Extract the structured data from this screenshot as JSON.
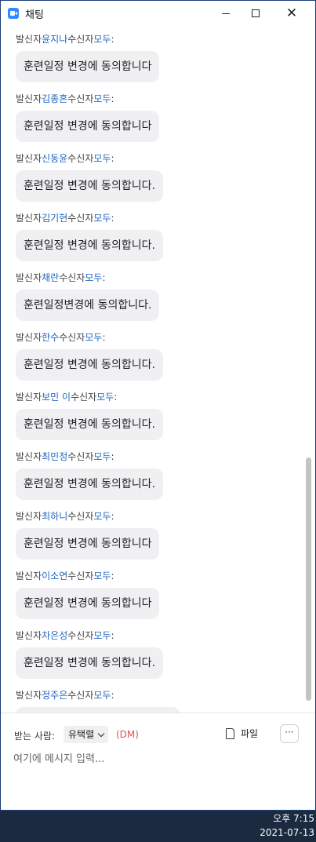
{
  "window": {
    "title": "채팅"
  },
  "messages": [
    {
      "prefix": "발신자",
      "sender": "윤지나",
      "mid": "수신자",
      "to": "모두",
      "suffix": ":",
      "text": "훈련일정 변경에 동의합니다"
    },
    {
      "prefix": "발신자",
      "sender": "김종흔",
      "mid": "수신자",
      "to": "모두",
      "suffix": ":",
      "text": "훈련일정 변경에 동의합니다"
    },
    {
      "prefix": "발신자",
      "sender": "신동윤",
      "mid": "수신자",
      "to": "모두",
      "suffix": ":",
      "text": "훈련일정 변경에 동의합니다."
    },
    {
      "prefix": "발신자",
      "sender": "김기현",
      "mid": "수신자",
      "to": "모두",
      "suffix": ":",
      "text": "훈련일정 변경에 동의합니다."
    },
    {
      "prefix": "발신자",
      "sender": "채란",
      "mid": "수신자",
      "to": "모두",
      "suffix": ":",
      "text": "훈련일정변경에 동의합니다."
    },
    {
      "prefix": "발신자",
      "sender": "한수",
      "mid": "수신자",
      "to": "모두",
      "suffix": ":",
      "text": "훈련일정 변경에 동의합니다."
    },
    {
      "prefix": "발신자",
      "sender": "보민 이",
      "mid": "수신자",
      "to": "모두",
      "suffix": ":",
      "text": "훈련일정 변경에 동의합니다."
    },
    {
      "prefix": "발신자",
      "sender": "최민정",
      "mid": "수신자",
      "to": "모두",
      "suffix": ":",
      "text": "훈련일정 변경에 동의합니다."
    },
    {
      "prefix": "발신자",
      "sender": "최하니",
      "mid": "수신자",
      "to": "모두",
      "suffix": ":",
      "text": "훈련일정 변경에 동의합니다"
    },
    {
      "prefix": "발신자",
      "sender": "이소연",
      "mid": "수신자",
      "to": "모두",
      "suffix": ":",
      "text": "훈련일정 변경에 동의합니다"
    },
    {
      "prefix": "발신자",
      "sender": "차은성",
      "mid": "수신자",
      "to": "모두",
      "suffix": ":",
      "text": "훈련일정 변경에 동의합니다."
    },
    {
      "prefix": "발신자",
      "sender": "정주은",
      "mid": "수신자",
      "to": "모두",
      "suffix": ":",
      "text": ""
    }
  ],
  "composer": {
    "recipient_label": "받는 사람:",
    "recipient_value": "유택렬",
    "dm_label": "(DM)",
    "file_label": "파일",
    "more_label": "···",
    "input_placeholder": "여기에 메시지 입력..."
  },
  "taskbar": {
    "time": "오후 7:15",
    "date": "2021-07-13"
  },
  "colors": {
    "sender_accent": "#1f66c1",
    "dm_red": "#e0524f",
    "bubble_bg": "#f0f0f3",
    "taskbar_bg": "#1b2a3f"
  }
}
